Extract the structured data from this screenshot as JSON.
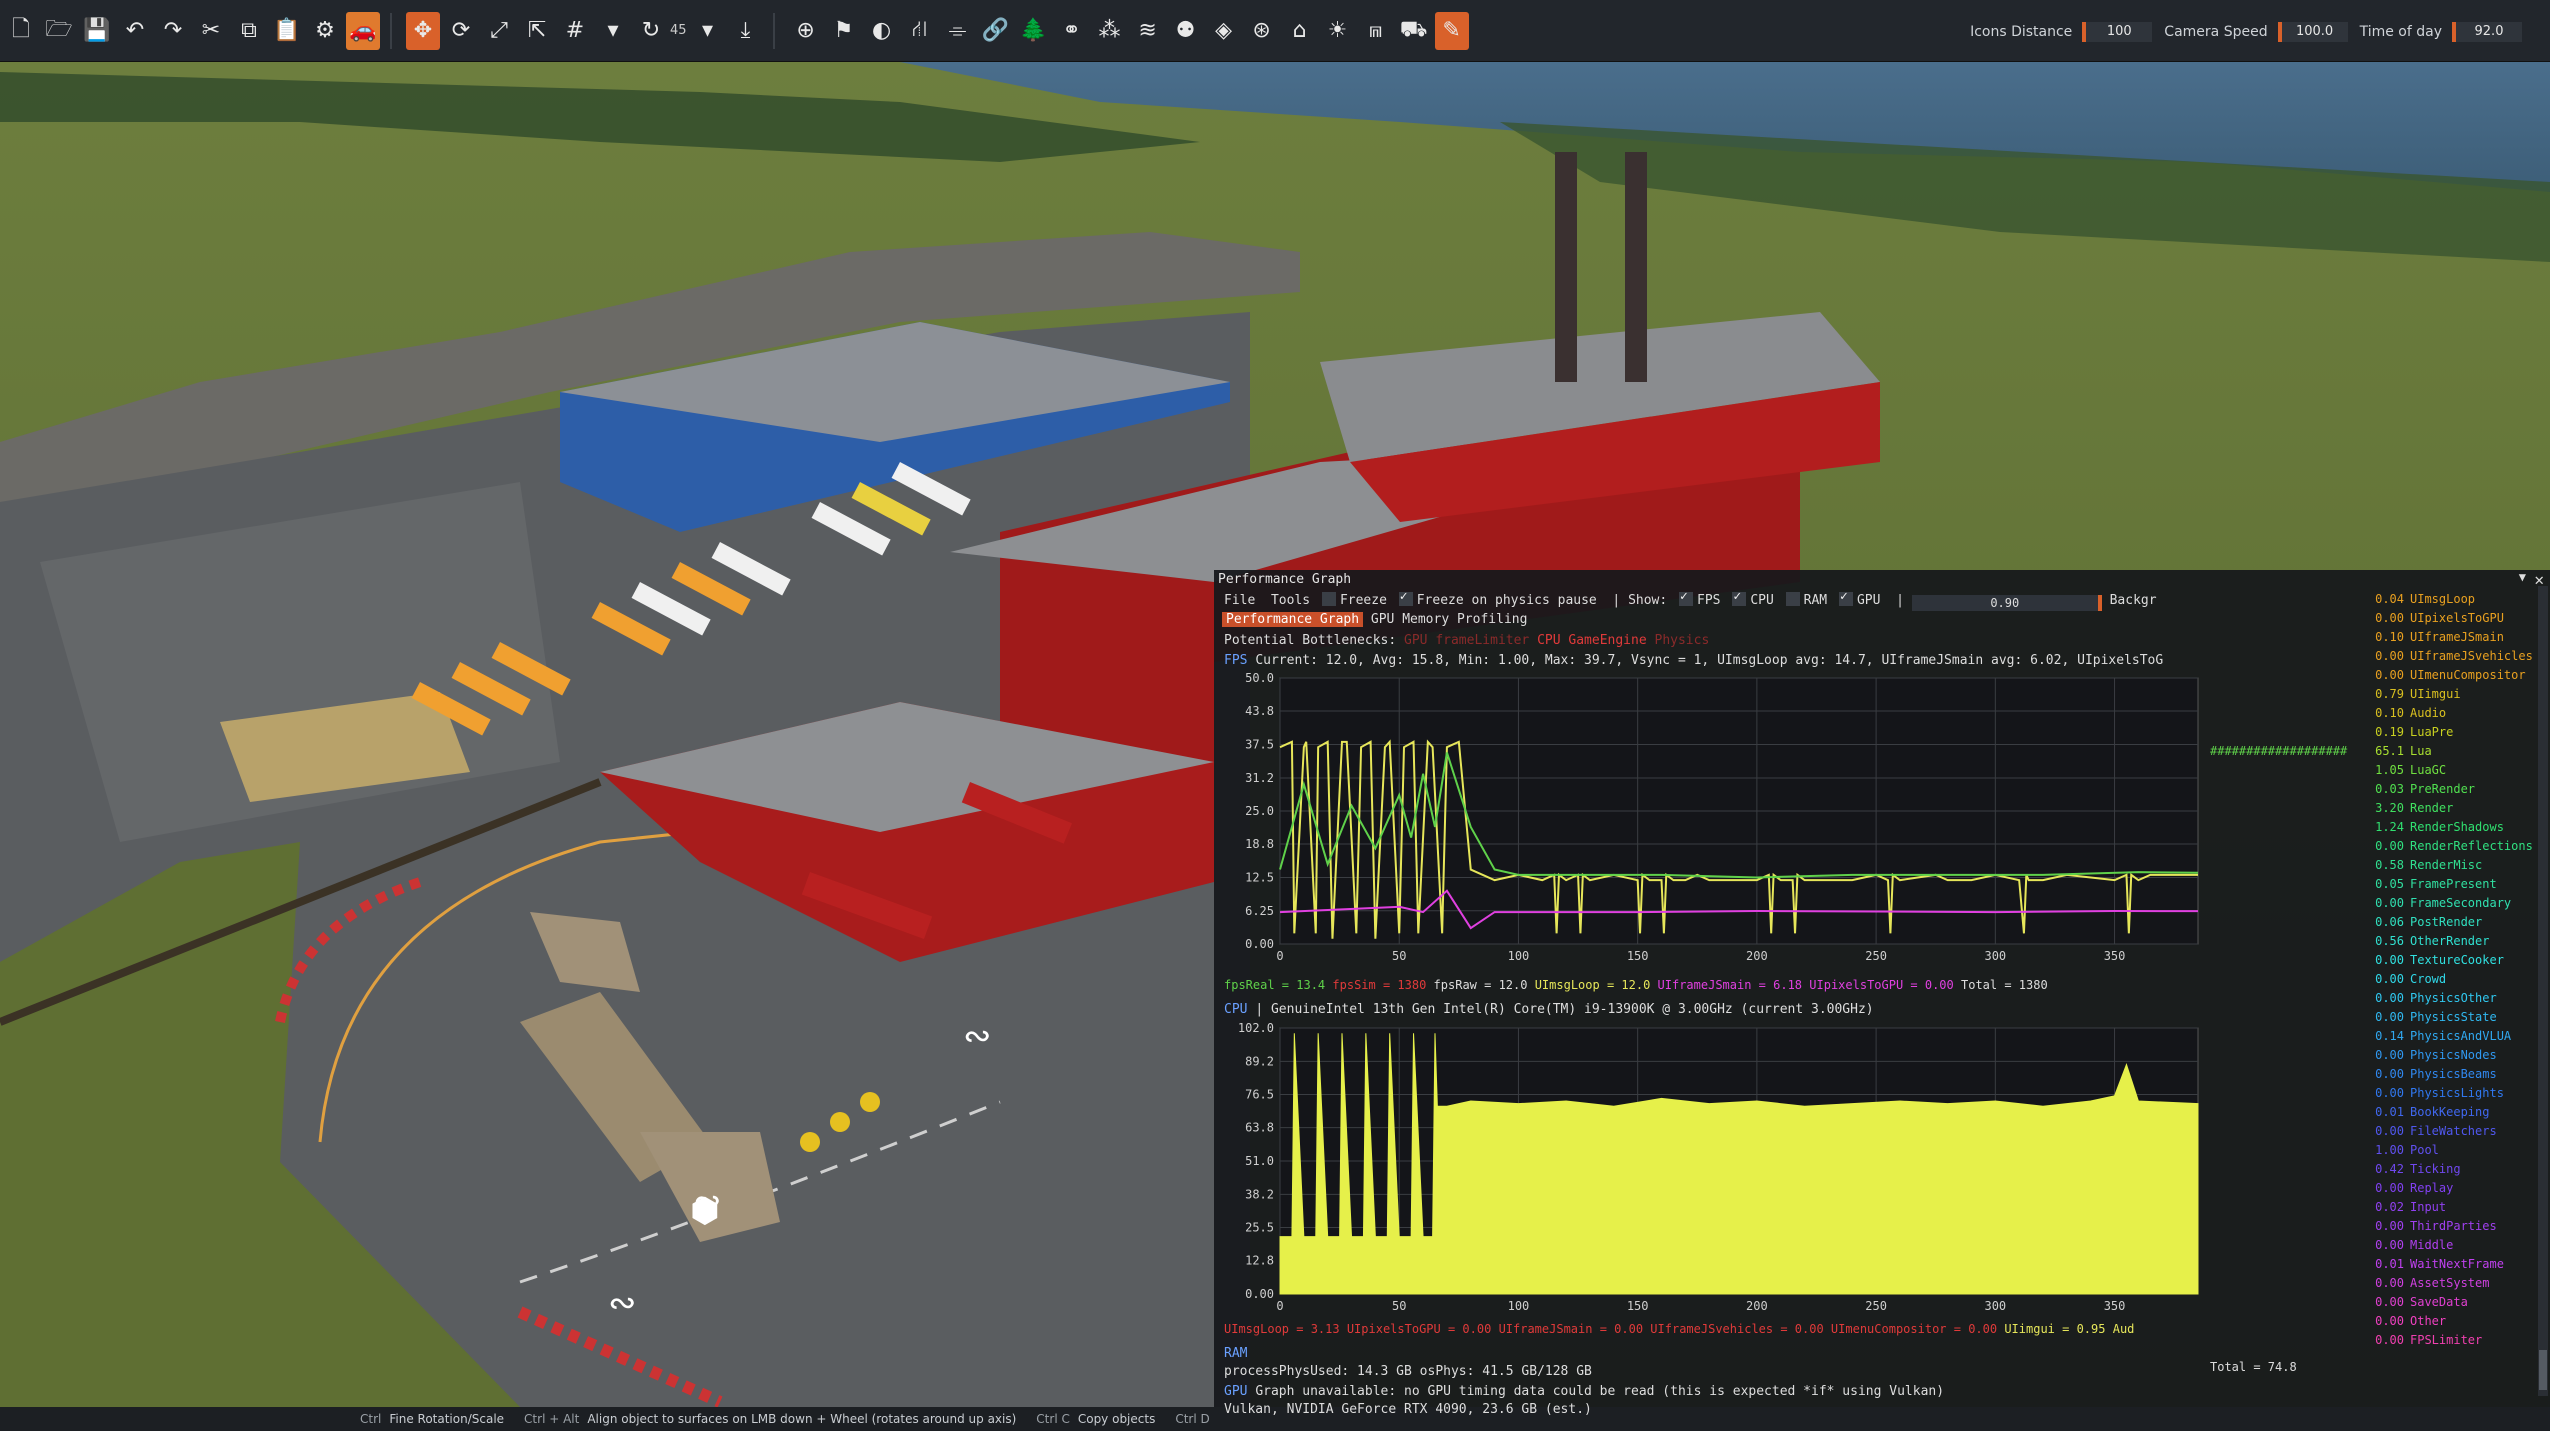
{
  "toolbar": {
    "rotation_value": "45",
    "icons_distance_label": "Icons Distance",
    "icons_distance_value": "100",
    "camera_speed_label": "Camera Speed",
    "camera_speed_value": "100.0",
    "time_of_day_label": "Time of day",
    "time_of_day_value": "92.0"
  },
  "perf": {
    "title": "Performance Graph",
    "menu_file": "File",
    "menu_tools": "Tools",
    "freeze_label": "Freeze",
    "freeze_physics_label": "Freeze on physics pause",
    "show_label": "Show:",
    "show_fps": "FPS",
    "show_cpu": "CPU",
    "show_ram": "RAM",
    "show_gpu": "GPU",
    "opacity_value": "0.90",
    "background_label": "Backgr",
    "tab_perf": "Performance Graph",
    "tab_gpu_mem": "GPU Memory Profiling",
    "bottlenecks_label": "Potential Bottlenecks:",
    "bn_gpu": "GPU",
    "bn_framelimiter": "frameLimiter",
    "bn_cpu": "CPU",
    "bn_gameengine": "GameEngine",
    "bn_physics": "Physics",
    "fps_label": "FPS",
    "fps_stats": "Current:  12.0, Avg:  15.8, Min:  1.00, Max:  39.7, Vsync = 1, UImsgLoop avg:  14.7, UIframeJSmain avg:  6.02, UIpixelsToG",
    "fps_legend_fpsreal": "fpsReal =  13.4",
    "fps_legend_fpssim": "fpsSim =  1380",
    "fps_legend_fpsraw": "fpsRaw =  12.0",
    "fps_legend_uimsgloop": "UImsgLoop =  12.0",
    "fps_legend_uiframejsmain": "UIframeJSmain =  6.18",
    "fps_legend_uipixelstogpu": "UIpixelsToGPU =  0.00",
    "fps_legend_total": "Total =  1380",
    "cpu_label": "CPU",
    "cpu_info": "| GenuineIntel 13th Gen Intel(R) Core(TM) i9-13900K @ 3.00GHz (current 3.00GHz)",
    "cpu_legend_a": "UImsgLoop =  3.13",
    "cpu_legend_b": "UIpixelsToGPU =  0.00",
    "cpu_legend_c": "UIframeJSmain =  0.00",
    "cpu_legend_d": "UIframeJSvehicles =  0.00",
    "cpu_legend_e": "UImenuCompositor =  0.00",
    "cpu_legend_f": "UIimgui =  0.95",
    "cpu_legend_g": "Aud",
    "ram_label": "RAM",
    "ram_info": "processPhysUsed:  14.3 GB   osPhys:  41.5 GB/128 GB",
    "gpu_label": "GPU",
    "gpu_info": "Graph unavailable: no GPU timing data could be read (this is expected *if* using Vulkan)",
    "gpu_device": "Vulkan, NVIDIA GeForce RTX 4090, 23.6 GB (est.)",
    "total_label": "Total =  74.8"
  },
  "sidebar_items": [
    {
      "v": "0.04",
      "n": "UImsgLoop",
      "c": "#e8a020"
    },
    {
      "v": "0.00",
      "n": "UIpixelsToGPU",
      "c": "#e8a020"
    },
    {
      "v": "0.10",
      "n": "UIframeJSmain",
      "c": "#e8a020"
    },
    {
      "v": "0.00",
      "n": "UIframeJSvehicles",
      "c": "#e8a020"
    },
    {
      "v": "0.00",
      "n": "UImenuCompositor",
      "c": "#e8a020"
    },
    {
      "v": "0.79",
      "n": "UIimgui",
      "c": "#d9c020"
    },
    {
      "v": "0.10",
      "n": "Audio",
      "c": "#d9c020"
    },
    {
      "v": "0.19",
      "n": "LuaPre",
      "c": "#c8d020"
    },
    {
      "v": "65.1",
      "n": "Lua",
      "c": "#a8e030"
    },
    {
      "v": "1.05",
      "n": "LuaGC",
      "c": "#70e040"
    },
    {
      "v": "0.03",
      "n": "PreRender",
      "c": "#50e050"
    },
    {
      "v": "3.20",
      "n": "Render",
      "c": "#40e060"
    },
    {
      "v": "1.24",
      "n": "RenderShadows",
      "c": "#30e070"
    },
    {
      "v": "0.00",
      "n": "RenderReflections",
      "c": "#30e080"
    },
    {
      "v": "0.58",
      "n": "RenderMisc",
      "c": "#30e090"
    },
    {
      "v": "0.05",
      "n": "FramePresent",
      "c": "#30e0a0"
    },
    {
      "v": "0.00",
      "n": "FrameSecondary",
      "c": "#30e0b0"
    },
    {
      "v": "0.06",
      "n": "PostRender",
      "c": "#30e0c0"
    },
    {
      "v": "0.56",
      "n": "OtherRender",
      "c": "#30e0d0"
    },
    {
      "v": "0.00",
      "n": "TextureCooker",
      "c": "#30e0e0"
    },
    {
      "v": "0.00",
      "n": "Crowd",
      "c": "#30d8e8"
    },
    {
      "v": "0.00",
      "n": "PhysicsOther",
      "c": "#30c8f0"
    },
    {
      "v": "0.00",
      "n": "PhysicsState",
      "c": "#30b8f0"
    },
    {
      "v": "0.14",
      "n": "PhysicsAndVLUA",
      "c": "#30a8f0"
    },
    {
      "v": "0.00",
      "n": "PhysicsNodes",
      "c": "#3098f0"
    },
    {
      "v": "0.00",
      "n": "PhysicsBeams",
      "c": "#3088f0"
    },
    {
      "v": "0.00",
      "n": "PhysicsLights",
      "c": "#3078f0"
    },
    {
      "v": "0.01",
      "n": "BookKeeping",
      "c": "#4068f0"
    },
    {
      "v": "0.00",
      "n": "FileWatchers",
      "c": "#5058f0"
    },
    {
      "v": "1.00",
      "n": "Pool",
      "c": "#6050f0"
    },
    {
      "v": "0.42",
      "n": "Ticking",
      "c": "#7048f0"
    },
    {
      "v": "0.00",
      "n": "Replay",
      "c": "#8040f0"
    },
    {
      "v": "0.02",
      "n": "Input",
      "c": "#9040f0"
    },
    {
      "v": "0.00",
      "n": "ThirdParties",
      "c": "#a040f0"
    },
    {
      "v": "0.00",
      "n": "Middle",
      "c": "#b040f0"
    },
    {
      "v": "0.01",
      "n": "WaitNextFrame",
      "c": "#c040f0"
    },
    {
      "v": "0.00",
      "n": "AssetSystem",
      "c": "#d040e0"
    },
    {
      "v": "0.00",
      "n": "SaveData",
      "c": "#e040d0"
    },
    {
      "v": "0.00",
      "n": "Other",
      "c": "#f040c0"
    },
    {
      "v": "0.00",
      "n": "FPSLimiter",
      "c": "#f040b0"
    }
  ],
  "sidebar_hash": "###################",
  "statusbar": {
    "k1": "Ctrl",
    "t1": "Fine Rotation/Scale",
    "k2": "Ctrl + Alt",
    "t2": "Align object to surfaces on LMB down + Wheel (rotates around up axis)",
    "k3": "Ctrl C",
    "t3": "Copy objects",
    "k4": "Ctrl D"
  },
  "chart_data": [
    {
      "type": "line",
      "title": "FPS",
      "xlim": [
        0,
        385
      ],
      "ylim": [
        0,
        50
      ],
      "xticks": [
        0,
        50,
        100,
        150,
        200,
        250,
        300,
        350
      ],
      "yticks": [
        0.0,
        6.25,
        12.5,
        18.8,
        25.0,
        31.2,
        37.5,
        43.8,
        50.0
      ],
      "series": [
        {
          "name": "fpsRaw",
          "color": "#e6e65a",
          "x": [
            0,
            5,
            6,
            10,
            11,
            15,
            16,
            20,
            22,
            26,
            28,
            32,
            34,
            38,
            40,
            44,
            46,
            50,
            52,
            56,
            58,
            62,
            64,
            68,
            70,
            75,
            80,
            90,
            100,
            110,
            115,
            116,
            117,
            120,
            125,
            126,
            127,
            130,
            140,
            150,
            151,
            152,
            155,
            160,
            161,
            162,
            165,
            170,
            175,
            180,
            190,
            200,
            205,
            206,
            207,
            210,
            215,
            216,
            217,
            220,
            240,
            250,
            255,
            256,
            257,
            260,
            275,
            280,
            290,
            300,
            310,
            312,
            313,
            314,
            320,
            330,
            350,
            355,
            356,
            357,
            360,
            365,
            385
          ],
          "y": [
            37,
            38,
            2,
            37,
            38,
            2,
            37,
            38,
            1,
            38,
            38,
            2,
            37,
            38,
            1,
            37,
            38,
            2,
            37,
            38,
            2,
            38,
            37,
            2,
            37,
            38,
            14,
            12,
            13,
            12,
            13,
            2,
            13,
            12,
            13,
            2,
            13,
            12,
            13,
            12,
            2,
            13,
            12,
            12,
            2,
            13,
            12,
            12,
            13,
            12,
            12,
            12,
            13,
            2,
            13,
            12,
            12,
            2,
            13,
            12,
            12,
            13,
            12,
            2,
            13,
            12,
            13,
            12,
            12,
            13,
            12,
            2,
            13,
            12,
            12,
            13,
            12,
            13,
            2,
            13,
            12,
            13,
            13
          ]
        },
        {
          "name": "fpsReal",
          "color": "#5fd14a",
          "x": [
            0,
            10,
            20,
            30,
            40,
            50,
            55,
            60,
            65,
            70,
            80,
            90,
            100,
            120,
            140,
            160,
            200,
            240,
            280,
            320,
            360,
            385
          ],
          "y": [
            14,
            30,
            15,
            26,
            18,
            28,
            20,
            32,
            22,
            36,
            22,
            14,
            13,
            13,
            13,
            13,
            12.5,
            13,
            13,
            13,
            13.5,
            13.4
          ]
        },
        {
          "name": "UIframeJSmain",
          "color": "#e040e0",
          "x": [
            0,
            50,
            60,
            70,
            80,
            90,
            100,
            110,
            150,
            200,
            250,
            300,
            350,
            385
          ],
          "y": [
            6,
            7,
            6,
            10,
            3,
            6,
            6,
            6,
            6,
            6.2,
            6.1,
            6.0,
            6.2,
            6.18
          ]
        }
      ]
    },
    {
      "type": "area",
      "title": "CPU",
      "xlim": [
        0,
        385
      ],
      "ylim": [
        0,
        102
      ],
      "xticks": [
        0,
        50,
        100,
        150,
        200,
        250,
        300,
        350
      ],
      "yticks": [
        0.0,
        12.8,
        25.5,
        38.2,
        51.0,
        63.8,
        76.5,
        89.2,
        102.0
      ],
      "series": [
        {
          "name": "Lua",
          "color": "#e6f04a",
          "x": [
            0,
            5,
            6,
            10,
            15,
            16,
            20,
            25,
            26,
            30,
            35,
            36,
            40,
            45,
            46,
            50,
            55,
            56,
            60,
            64,
            65,
            66,
            70,
            80,
            100,
            120,
            140,
            160,
            180,
            200,
            220,
            240,
            260,
            280,
            300,
            320,
            340,
            350,
            355,
            360,
            385
          ],
          "y": [
            22,
            22,
            100,
            22,
            22,
            100,
            22,
            22,
            100,
            22,
            22,
            100,
            22,
            22,
            100,
            22,
            22,
            100,
            22,
            22,
            100,
            72,
            72,
            74,
            73,
            74,
            72,
            75,
            73,
            74,
            72,
            73,
            74,
            73,
            74,
            72,
            74,
            76,
            88,
            74,
            73
          ]
        }
      ]
    }
  ]
}
